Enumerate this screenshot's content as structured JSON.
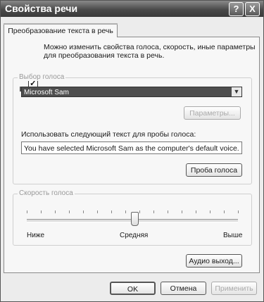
{
  "window": {
    "title": "Свойства речи",
    "help_label": "?",
    "close_label": "X"
  },
  "tab": {
    "label": "Преобразование текста в речь"
  },
  "intro": {
    "text_line1": "Можно изменить свойства голоса, скорость, иные параметры",
    "text_line2": "для преобразования текста в речь."
  },
  "voice_group": {
    "legend": "Выбор голоса",
    "selected_voice": "Microsoft Sam",
    "settings_button": "Параметры...",
    "preview_label": "Использовать следующий текст для пробы голоса:",
    "preview_text": "You have selected Microsoft Sam as the computer's default voice.",
    "preview_button": "Проба голоса"
  },
  "speed_group": {
    "legend": "Скорость голоса",
    "label_slow": "Ниже",
    "label_medium": "Средняя",
    "label_fast": "Выше",
    "level_percent": 50
  },
  "audio_button": "Аудио выход...",
  "footer": {
    "ok": "OK",
    "cancel": "Отмена",
    "apply": "Применить"
  }
}
